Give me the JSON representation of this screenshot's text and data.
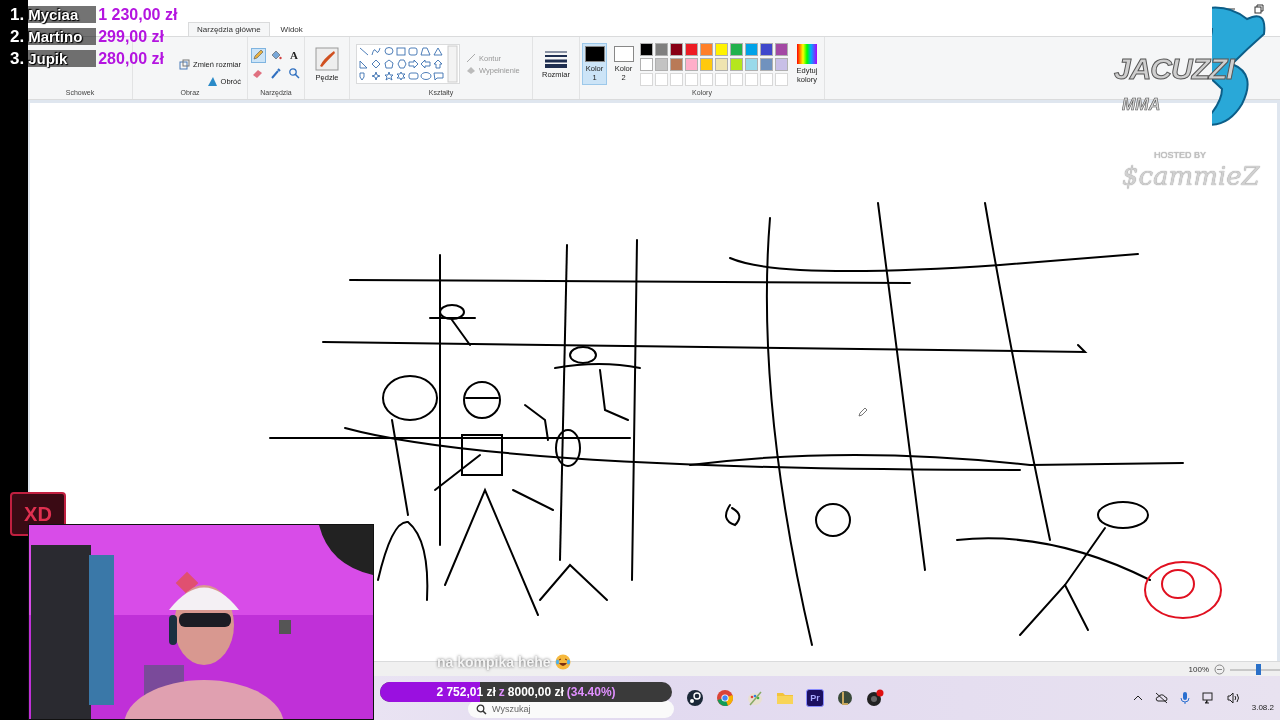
{
  "paint_window": {
    "tabs": [
      {
        "label": "Narzędzia główne",
        "selected": true
      },
      {
        "label": "Widok",
        "selected": false
      }
    ],
    "ribbon": {
      "clipboard": {
        "label": "Schowek"
      },
      "image": {
        "label": "Obraz",
        "items": [
          {
            "kind": "resize",
            "label": "Zmień rozmiar"
          },
          {
            "kind": "rotate",
            "label": "Obróć"
          }
        ]
      },
      "tools": {
        "label": "Narzędzia",
        "items": [
          {
            "kind": "pencil",
            "selected": true
          },
          {
            "kind": "fill",
            "selected": false
          },
          {
            "kind": "text",
            "label": "A",
            "selected": false
          },
          {
            "kind": "eraser",
            "selected": false
          },
          {
            "kind": "picker",
            "selected": false
          },
          {
            "kind": "magnifier",
            "selected": false
          }
        ]
      },
      "brushes": {
        "label": "Pędzle"
      },
      "shapes": {
        "label": "Kształty",
        "outline": "Kontur",
        "fill": "Wypełnienie"
      },
      "size": {
        "label": "Rozmiar"
      },
      "colors": {
        "label": "Kolory",
        "color1": {
          "label": "Kolor",
          "number": "1",
          "color": "#000000",
          "selected": true
        },
        "color2": {
          "label": "Kolor",
          "number": "2",
          "color": "#ffffff",
          "selected": false
        },
        "palette": [
          {
            "color": "#000000"
          },
          {
            "color": "#7f7f7f"
          },
          {
            "color": "#880015"
          },
          {
            "color": "#ed1c24"
          },
          {
            "color": "#ff7f27"
          },
          {
            "color": "#fff200"
          },
          {
            "color": "#22b14c"
          },
          {
            "color": "#00a2e8"
          },
          {
            "color": "#3f48cc"
          },
          {
            "color": "#a349a4"
          },
          {
            "color": "#ffffff"
          },
          {
            "color": "#c3c3c3"
          },
          {
            "color": "#b97a57"
          },
          {
            "color": "#ffaec9"
          },
          {
            "color": "#ffc90e"
          },
          {
            "color": "#efe4b0"
          },
          {
            "color": "#b5e61d"
          },
          {
            "color": "#99d9ea"
          },
          {
            "color": "#7092be"
          },
          {
            "color": "#c8bfe7"
          }
        ],
        "edit_colors": "Edytuj kolory"
      }
    },
    "status_bar": {
      "zoom": "100%",
      "level": 0.55
    }
  },
  "taskbar": {
    "search_placeholder": "Wyszukaj",
    "apps": [
      {
        "kind": "steam"
      },
      {
        "kind": "chrome"
      },
      {
        "kind": "paint"
      },
      {
        "kind": "folder"
      },
      {
        "kind": "premiere",
        "label": "Pr"
      },
      {
        "kind": "league"
      },
      {
        "kind": "obs"
      }
    ],
    "date": "3.08.2"
  },
  "stream_overlay": {
    "leaderboard": [
      {
        "rank": "1.",
        "name": "Myciaa",
        "amount": "1 230,00 zł"
      },
      {
        "rank": "2.",
        "name": "Martino",
        "amount": "299,00 zł"
      },
      {
        "rank": "3.",
        "name": "Jupik",
        "amount": "280,00 zł"
      }
    ],
    "logo": {
      "title": "JACUZZI",
      "subtitle": "MMA",
      "hosted_by": "HOSTED BY",
      "host": "$cammieZ"
    },
    "emote": "XD",
    "chat_message": "na kompika hehe",
    "goal": {
      "raised": "2 752,01 zł",
      "separator": "z",
      "target": "8000,00 zł",
      "percent": "(34.40%)",
      "level": 0.344
    }
  }
}
